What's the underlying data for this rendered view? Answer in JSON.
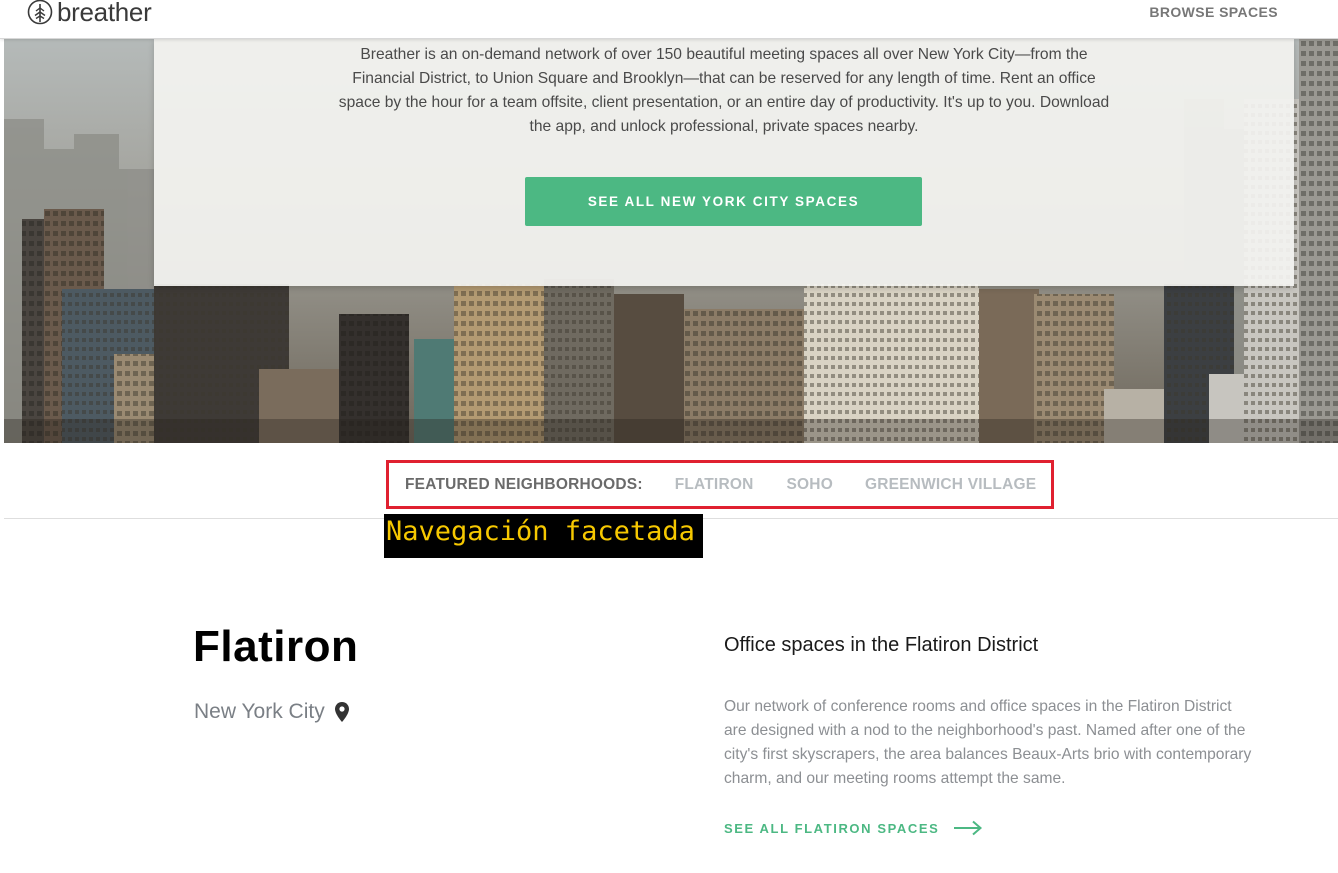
{
  "header": {
    "logo_text": "breather",
    "browse_label": "BROWSE SPACES"
  },
  "hero": {
    "description": "Breather is an on-demand network of over 150 beautiful meeting spaces all over New York City—from the Financial District, to Union Square and Brooklyn—that can be reserved for any length of time. Rent an office space by the hour for a team offsite, client presentation, or an entire day of productivity. It's up to you. Download the app, and unlock professional, private spaces nearby.",
    "cta_label": "SEE ALL NEW YORK CITY SPACES"
  },
  "neighborhoods": {
    "label": "FEATURED NEIGHBORHOODS:",
    "items": [
      "FLATIRON",
      "SOHO",
      "GREENWICH VILLAGE"
    ]
  },
  "annotation": {
    "text": "Navegación facetada"
  },
  "location": {
    "title": "Flatiron",
    "city": "New York City",
    "subtitle": "Office spaces in the Flatiron District",
    "description": "Our network of conference rooms and office spaces in the Flatiron District are designed with a nod to the neighborhood's past. Named after one of the city's first skyscrapers, the area balances Beaux-Arts brio with contemporary charm, and our meeting rooms attempt the same.",
    "link_label": "SEE ALL FLATIRON SPACES"
  },
  "colors": {
    "accent_green": "#4cb883",
    "highlight_border": "#e02030",
    "annotation_text": "#f6c800",
    "annotation_bg": "#000000"
  },
  "icons": {
    "logo": "tree-in-circle-icon",
    "location": "map-pin-icon",
    "link_arrow": "arrow-right-icon"
  }
}
